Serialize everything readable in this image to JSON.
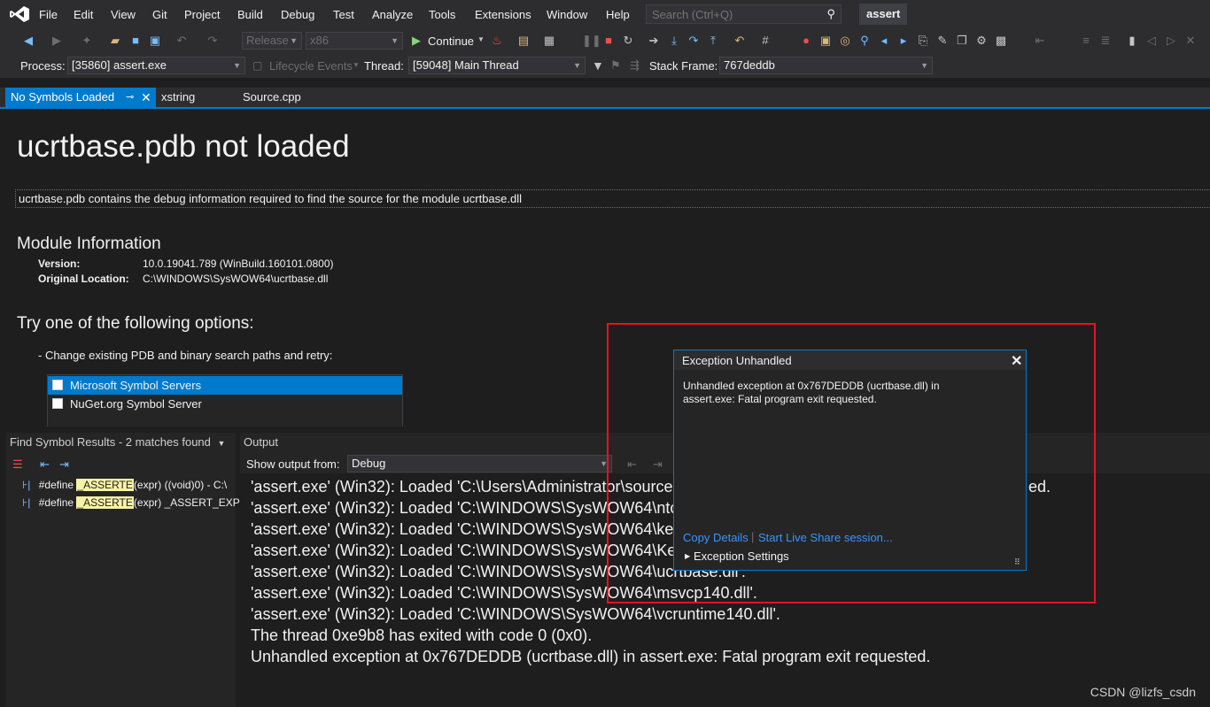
{
  "menubar": {
    "items": [
      "File",
      "Edit",
      "View",
      "Git",
      "Project",
      "Build",
      "Debug",
      "Test",
      "Analyze",
      "Tools",
      "Extensions",
      "Window",
      "Help"
    ],
    "search_placeholder": "Search (Ctrl+Q)",
    "solution_title": "assert"
  },
  "toolbar1": {
    "config": "Release",
    "platform": "x86",
    "continue_label": "Continue"
  },
  "toolbar2": {
    "process_label": "Process:",
    "process_value": "[35860] assert.exe",
    "lifecycle_label": "Lifecycle Events",
    "thread_label": "Thread:",
    "thread_value": "[59048] Main Thread",
    "stackframe_label": "Stack Frame:",
    "stackframe_value": "767deddb"
  },
  "tabs": [
    {
      "label": "No Symbols Loaded",
      "active": true
    },
    {
      "label": "xstring",
      "active": false
    },
    {
      "label": "Source.cpp",
      "active": false
    }
  ],
  "doc": {
    "title": "ucrtbase.pdb not loaded",
    "description": "ucrtbase.pdb contains the debug information required to find the source for the module ucrtbase.dll",
    "module_heading": "Module Information",
    "version_key": "Version:",
    "version_value": "10.0.19041.789 (WinBuild.160101.0800)",
    "location_key": "Original Location:",
    "location_value": "C:\\WINDOWS\\SysWOW64\\ucrtbase.dll",
    "options_heading": "Try one of the following options:",
    "option1": "-  Change existing PDB and binary search paths and retry:",
    "symbol_servers": [
      {
        "label": "Microsoft Symbol Servers",
        "selected": true,
        "checked": false
      },
      {
        "label": "NuGet.org Symbol Server",
        "selected": false,
        "checked": false
      }
    ]
  },
  "find_panel": {
    "title": "Find Symbol Results - 2 matches found",
    "results": [
      {
        "prefix": "#define ",
        "match": "_ASSERTE",
        "suffix": "(expr) ((void)0) - C:\\"
      },
      {
        "prefix": "#define ",
        "match": "_ASSERTE",
        "suffix": "(expr) _ASSERT_EXP"
      }
    ]
  },
  "output_panel": {
    "title": "Output",
    "show_from_label": "Show output from:",
    "show_from_value": "Debug",
    "lines": [
      "'assert.exe' (Win32): Loaded 'C:\\Users\\Administrator\\source",
      "'assert.exe' (Win32): Loaded 'C:\\WINDOWS\\SysWOW64\\ntc",
      "'assert.exe' (Win32): Loaded 'C:\\WINDOWS\\SysWOW64\\ke",
      "'assert.exe' (Win32): Loaded 'C:\\WINDOWS\\SysWOW64\\Ke",
      "'assert.exe' (Win32): Loaded 'C:\\WINDOWS\\SysWOW64\\ucrtbase.dll'.",
      "'assert.exe' (Win32): Loaded 'C:\\WINDOWS\\SysWOW64\\msvcp140.dll'.",
      "'assert.exe' (Win32): Loaded 'C:\\WINDOWS\\SysWOW64\\vcruntime140.dll'.",
      "The thread 0xe9b8 has exited with code 0 (0x0).",
      "Unhandled exception at 0x767DEDDB (ucrtbase.dll) in assert.exe: Fatal program exit requested."
    ],
    "line1_tail": "ed."
  },
  "dialog": {
    "title": "Exception Unhandled",
    "message_line1": "Unhandled exception at 0x767DEDDB (ucrtbase.dll) in",
    "message_line2": "assert.exe: Fatal program exit requested.",
    "copy_details": "Copy Details",
    "separator": "|",
    "live_share": "Start Live Share session...",
    "exception_settings": "Exception Settings"
  },
  "watermark": "CSDN @lizfs_csdn",
  "colors": {
    "accent": "#007acc",
    "red_frame": "#e81123",
    "link": "#3794ff",
    "highlight": "#f7f2a6"
  }
}
